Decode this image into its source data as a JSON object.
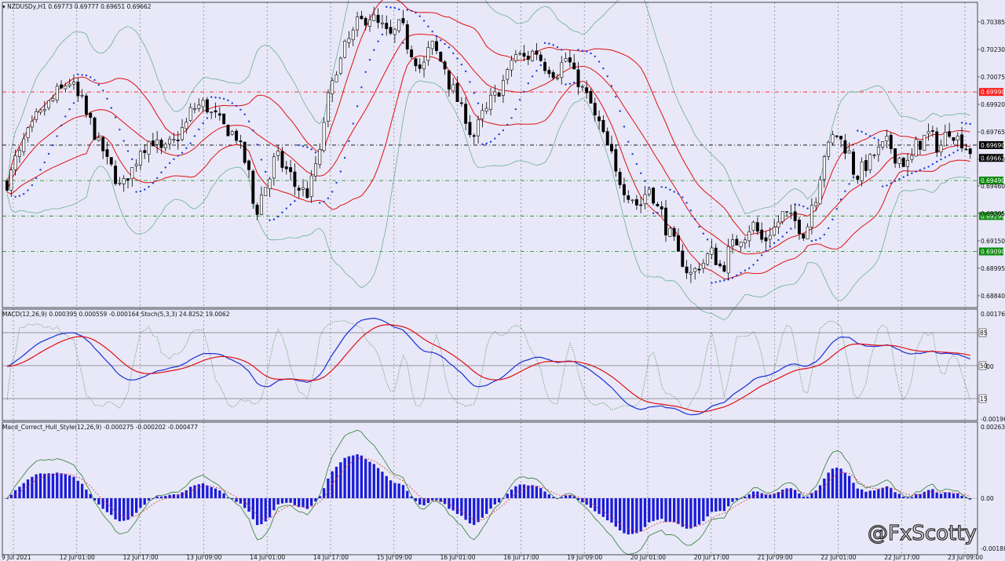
{
  "chart_data": {
    "type": "candlestick",
    "symbol": "NZDUSDy,H1",
    "ohlc": [
      "0.69773",
      "0.69777",
      "0.69651",
      "0.69662"
    ],
    "price_axis": {
      "ticks": [
        "0.70385",
        "0.70230",
        "0.70075",
        "0.69920",
        "0.69765",
        "0.69610",
        "0.69460",
        "0.69305",
        "0.69150",
        "0.68995",
        "0.68840"
      ],
      "range": [
        0.688,
        0.7046
      ]
    },
    "price_levels": [
      {
        "value": "0.69990",
        "color": "#ff1a1a",
        "style": "dash"
      },
      {
        "value": "0.69690",
        "color": "#000000",
        "style": "dash"
      },
      {
        "value": "0.69490",
        "color": "#0a8a0a",
        "style": "dash"
      },
      {
        "value": "0.69290",
        "color": "#0a8a0a",
        "style": "dash"
      },
      {
        "value": "0.69090",
        "color": "#0a8a0a",
        "style": "dash"
      }
    ],
    "current_price": "0.69662",
    "x_labels": [
      "9 Jul 2021",
      "12 Jul 01:00",
      "12 Jul 17:00",
      "13 Jul 09:00",
      "14 Jul 01:00",
      "14 Jul 17:00",
      "15 Jul 09:00",
      "16 Jul 01:00",
      "16 Jul 17:00",
      "19 Jul 09:00",
      "20 Jul 01:00",
      "20 Jul 17:00",
      "21 Jul 09:00",
      "22 Jul 01:00",
      "22 Jul 17:00",
      "23 Jul 09:00"
    ],
    "close_path": [
      0.6948,
      0.6962,
      0.6975,
      0.6985,
      0.6992,
      0.6999,
      0.7005,
      0.6995,
      0.6982,
      0.6968,
      0.6956,
      0.6945,
      0.6955,
      0.6968,
      0.6972,
      0.6965,
      0.697,
      0.6978,
      0.699,
      0.6992,
      0.6985,
      0.6979,
      0.6975,
      0.696,
      0.6932,
      0.6946,
      0.6962,
      0.6955,
      0.6945,
      0.6942,
      0.696,
      0.6995,
      0.7015,
      0.7028,
      0.7038,
      0.7042,
      0.7036,
      0.703,
      0.7036,
      0.7022,
      0.7012,
      0.7025,
      0.7016,
      0.7,
      0.6988,
      0.6974,
      0.6986,
      0.6996,
      0.7005,
      0.702,
      0.7018,
      0.7022,
      0.7014,
      0.701,
      0.7018,
      0.7006,
      0.6996,
      0.6982,
      0.6968,
      0.695,
      0.6942,
      0.6935,
      0.6945,
      0.6932,
      0.6918,
      0.6905,
      0.6896,
      0.6902,
      0.6908,
      0.69,
      0.6912,
      0.6918,
      0.6924,
      0.6915,
      0.6922,
      0.693,
      0.6926,
      0.692,
      0.694,
      0.6965,
      0.6975,
      0.6968,
      0.6952,
      0.6958,
      0.6965,
      0.697,
      0.6962,
      0.6958,
      0.697,
      0.6975,
      0.6968,
      0.6978,
      0.6972,
      0.6966
    ],
    "macd_panel": {
      "label": "MACD(12,26,9) 0.000395 0.000559 -0.000164  Stoch(5,3,3) 24.8252 19.0062",
      "ticks": [
        "0.001766",
        "0.00",
        "-0.001961"
      ],
      "levels": [
        "85",
        "50",
        "15"
      ]
    },
    "hull_panel": {
      "label": "Macd_Correct_Hull_Style(12,26,9) -0.000275 -0.000202 -0.000477",
      "ticks": [
        "0.002635",
        "0.00",
        "-0.001881"
      ]
    },
    "colors": {
      "bull": "#ffffff",
      "bear": "#000000",
      "band": "#e01010",
      "outer": "#5aa78a",
      "sar": "#1a3ed6",
      "macd": "#1a2fd6",
      "signal": "#e01010",
      "hist": "#1a1ad8"
    },
    "watermark": "@FxScotty"
  }
}
